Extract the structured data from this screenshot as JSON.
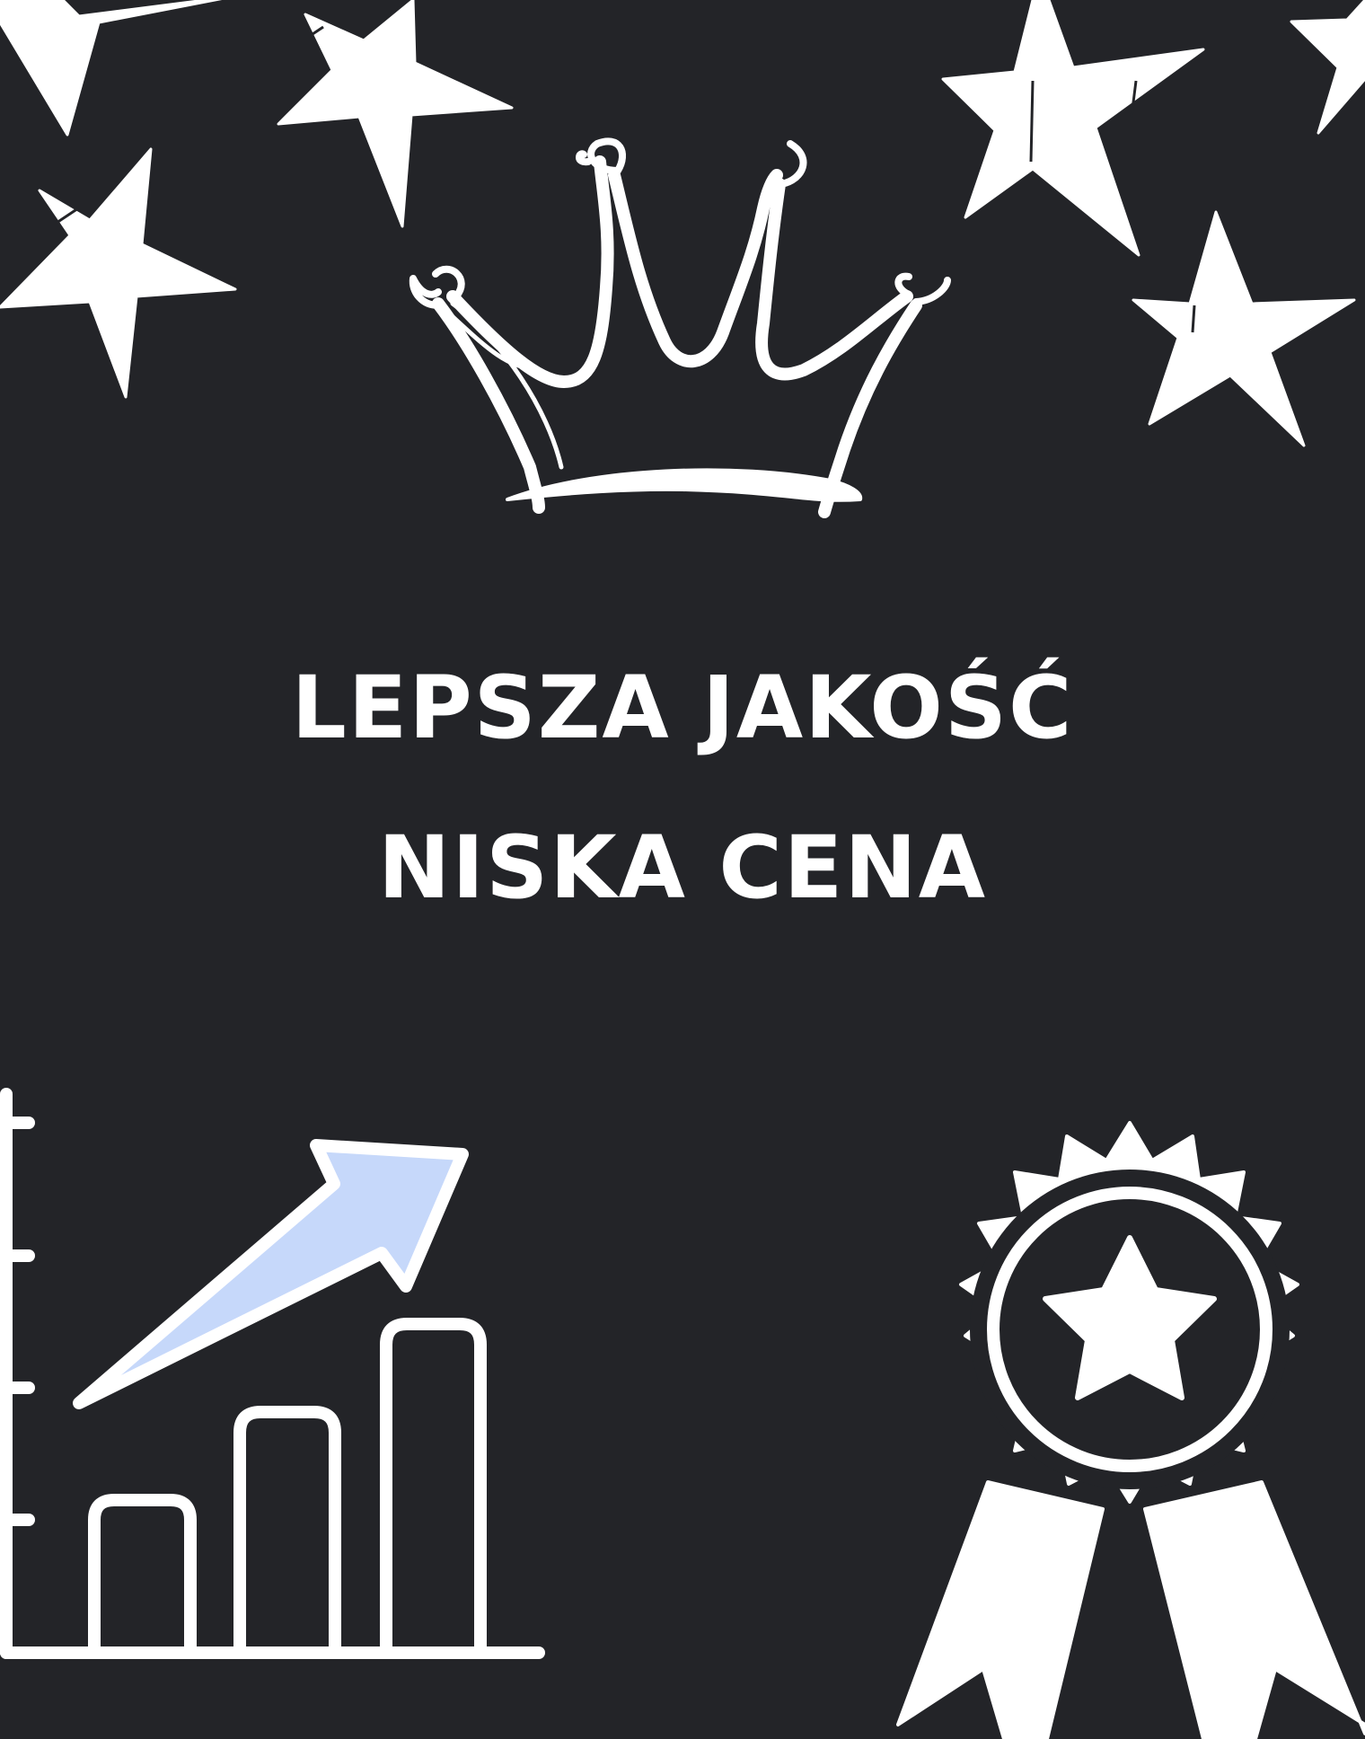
{
  "headline": {
    "line1": "LEPSZA JAKOŚĆ",
    "line2": "NISKA CENA"
  },
  "colors": {
    "background": "#232428",
    "foreground": "#ffffff",
    "accent": "#c6d8fa"
  },
  "icons": [
    "crown-icon",
    "star-icon",
    "growth-chart-icon",
    "award-badge-icon"
  ]
}
